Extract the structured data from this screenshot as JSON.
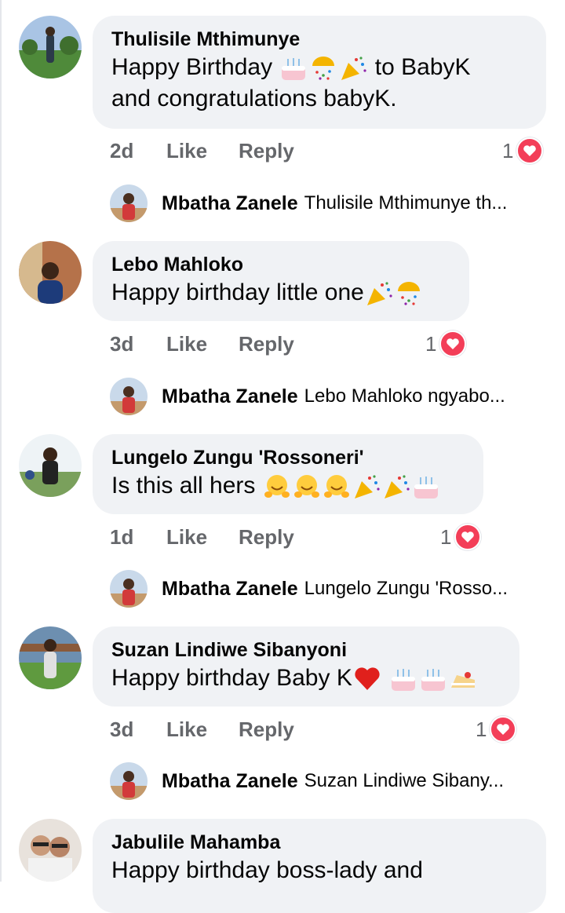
{
  "comments": [
    {
      "author": "Thulisile Mthimunye",
      "text_before": "Happy Birthday",
      "emojis": [
        "cake",
        "confetti-ball",
        "party-popper"
      ],
      "text_after": "to BabyK",
      "text_line2": "and congratulations babyK.",
      "time": "2d",
      "like_label": "Like",
      "reply_label": "Reply",
      "reaction_count": "1",
      "reply": {
        "author": "Mbatha Zanele",
        "preview": "Thulisile Mthimunye th..."
      }
    },
    {
      "author": "Lebo Mahloko",
      "text_before": "Happy birthday little one",
      "emojis": [
        "party-popper",
        "confetti-ball"
      ],
      "time": "3d",
      "like_label": "Like",
      "reply_label": "Reply",
      "reaction_count": "1",
      "reply": {
        "author": "Mbatha Zanele",
        "preview": "Lebo Mahloko ngyabo..."
      }
    },
    {
      "author": "Lungelo Zungu 'Rossoneri'",
      "text_before": "Is this all hers",
      "emojis": [
        "hugging-face",
        "hugging-face",
        "hugging-face",
        "party-popper",
        "party-popper",
        "cake"
      ],
      "time": "1d",
      "like_label": "Like",
      "reply_label": "Reply",
      "reaction_count": "1",
      "reply": {
        "author": "Mbatha Zanele",
        "preview": "Lungelo Zungu 'Rosso..."
      }
    },
    {
      "author": "Suzan Lindiwe Sibanyoni",
      "text_before": "Happy birthday Baby K",
      "emojis": [
        "red-heart",
        "cake",
        "cake",
        "shortcake"
      ],
      "time": "3d",
      "like_label": "Like",
      "reply_label": "Reply",
      "reaction_count": "1",
      "reply": {
        "author": "Mbatha Zanele",
        "preview": "Suzan Lindiwe Sibany..."
      }
    },
    {
      "author": "Jabulile Mahamba",
      "text_before": "Happy birthday boss-lady and"
    }
  ],
  "colors": {
    "bubble": "#f0f2f5",
    "meta": "#65676b",
    "heart": "#f33e58"
  },
  "icons": [
    "heart-reaction-icon"
  ]
}
